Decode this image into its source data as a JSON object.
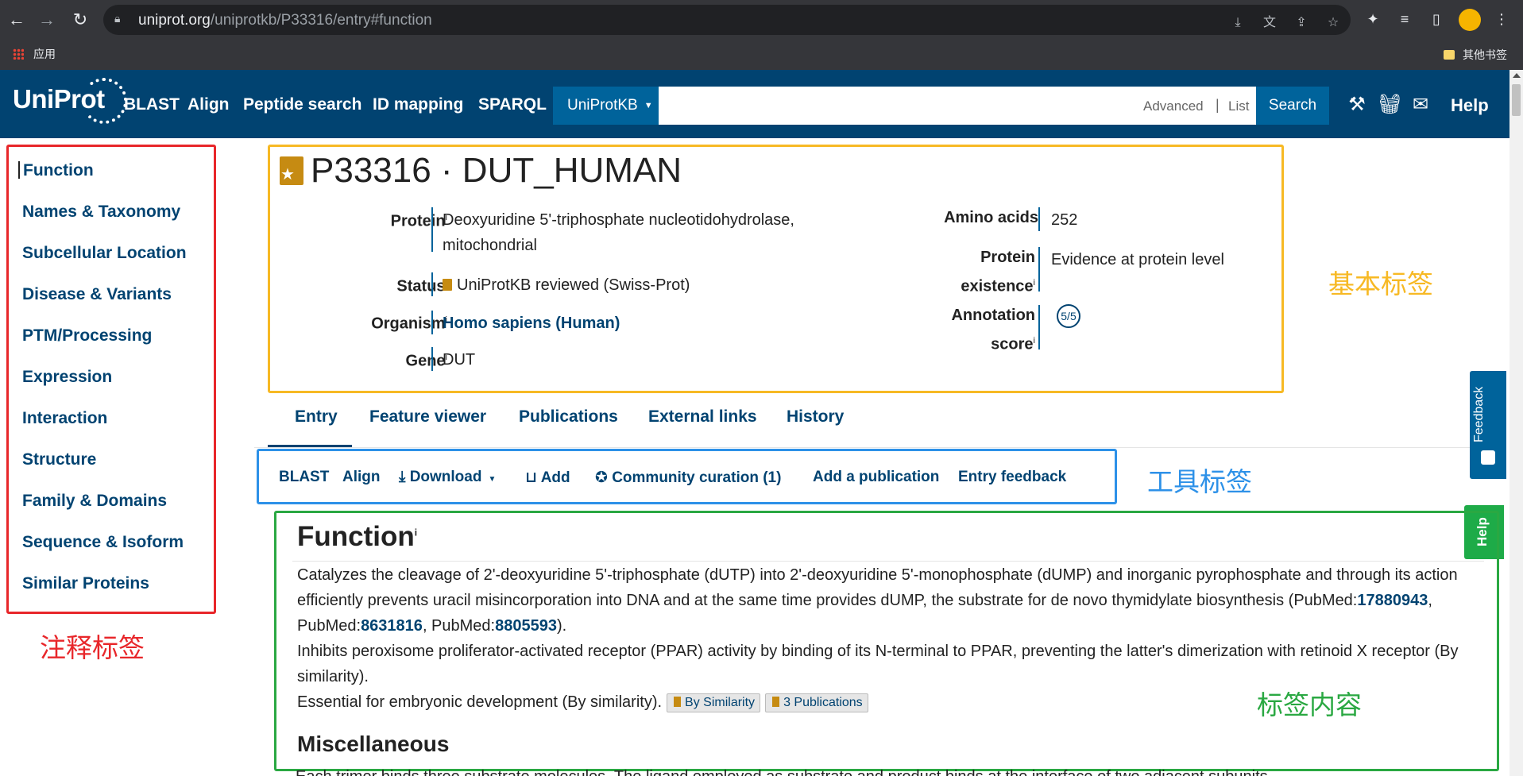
{
  "browser": {
    "url_host": "uniprot.org",
    "url_path": "/uniprotkb/P33316/entry#function",
    "bookmark_apps": "应用",
    "bookmark_other": "其他书签"
  },
  "header": {
    "logo": "UniProt",
    "nav": [
      "BLAST",
      "Align",
      "Peptide search",
      "ID mapping",
      "SPARQL"
    ],
    "db_select": "UniProtKB",
    "advanced": "Advanced",
    "separator": "|",
    "list": "List",
    "search_button": "Search",
    "help": "Help"
  },
  "sidebar": {
    "items": [
      "Function",
      "Names & Taxonomy",
      "Subcellular Location",
      "Disease & Variants",
      "PTM/Processing",
      "Expression",
      "Interaction",
      "Structure",
      "Family & Domains",
      "Sequence & Isoform",
      "Similar Proteins"
    ],
    "annotation": "注释标签"
  },
  "entry": {
    "title": "P33316 · DUT_HUMAN",
    "fields": {
      "protein_label": "Protein",
      "protein_value_1": "Deoxyuridine 5'-triphosphate nucleotidohydrolase,",
      "protein_value_2": "mitochondrial",
      "status_label": "Status",
      "status_value": "UniProtKB reviewed (Swiss-Prot)",
      "organism_label": "Organism",
      "organism_value": "Homo sapiens (Human)",
      "gene_label": "Gene",
      "gene_value": "DUT",
      "amino_label": "Amino acids",
      "amino_value": "252",
      "existence_label_1": "Protein",
      "existence_label_2": "existence",
      "existence_value": "Evidence at protein level",
      "annotation_label_1": "Annotation",
      "annotation_label_2": "score",
      "annotation_value": "5/5",
      "info_mark": "i"
    },
    "annotation": "基本标签"
  },
  "tabs": [
    "Entry",
    "Feature viewer",
    "Publications",
    "External links",
    "History"
  ],
  "tools": {
    "items": [
      "BLAST",
      "Align",
      "Download",
      "Add",
      "Community curation (1)",
      "Add a publication",
      "Entry feedback"
    ],
    "annotation": "工具标签"
  },
  "side_tabs": {
    "feedback": "Feedback",
    "help": "Help"
  },
  "content": {
    "title": "Function",
    "para1_a": "Catalyzes the cleavage of 2'-deoxyuridine 5'-triphosphate (dUTP) into 2'-deoxyuridine 5'-monophosphate (dUMP) and inorganic pyrophosphate and through its action efficiently prevents uracil misincorporation into DNA and at the same time provides dUMP, the substrate for de novo thymidylate biosynthesis (PubMed:",
    "pm1": "17880943",
    "para1_b": ", PubMed:",
    "pm2": "8631816",
    "para1_c": ", PubMed:",
    "pm3": "8805593",
    "para1_d": ").",
    "para2": "Inhibits peroxisome proliferator-activated receptor (PPAR) activity by binding of its N-terminal to PPAR, preventing the latter's dimerization with retinoid X receptor (By similarity).",
    "para3": "Essential for embryonic development (By similarity).",
    "tag1": "By Similarity",
    "tag2": "3 Publications",
    "misc_title": "Miscellaneous",
    "bottom_text": "Each trimer binds three substrate molecules. The ligand employed as substrate and product binds at the interface of two adjacent subunits",
    "annotation": "标签内容"
  },
  "colors": {
    "uniprot_blue": "#014371",
    "accent_blue": "#00639b",
    "red_box": "#e8262a",
    "orange_box": "#f7b924",
    "blue_box": "#2d91e8",
    "green_box": "#2aa842"
  }
}
